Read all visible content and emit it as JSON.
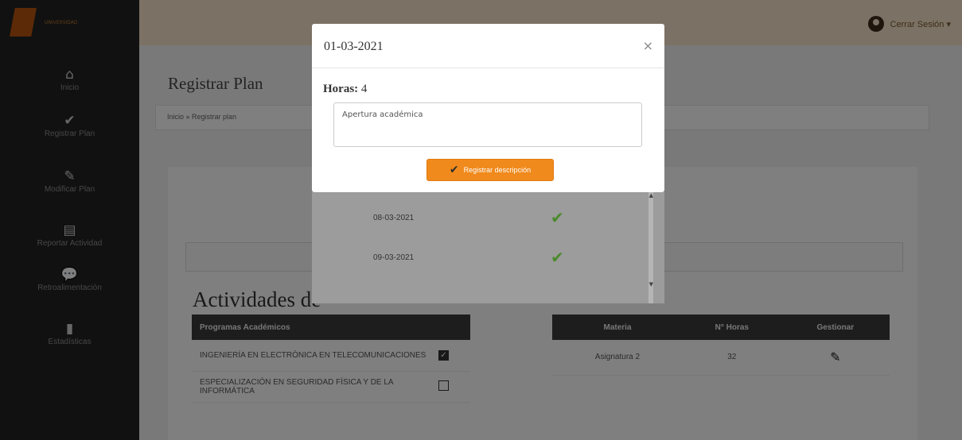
{
  "brand": {
    "logo_text": "UNIVERSIDAD"
  },
  "sidebar": {
    "items": [
      {
        "icon": "home-icon",
        "glyph": "⌂",
        "label": "Inicio"
      },
      {
        "icon": "check-icon",
        "glyph": "✔",
        "label": "Registrar Plan"
      },
      {
        "icon": "pencil-icon",
        "glyph": "✎",
        "label": "Modificar Plan"
      },
      {
        "icon": "file-icon",
        "glyph": "▤",
        "label": "Reportar Actividad"
      },
      {
        "icon": "comment-icon",
        "glyph": "💬",
        "label": "Retroalimentación"
      },
      {
        "icon": "bar-chart-icon",
        "glyph": "▮",
        "label": "Estadísticas"
      }
    ]
  },
  "topbar": {
    "user_name": "Cerrar Sesión ▾"
  },
  "main": {
    "page_title": "Registrar Plan",
    "breadcrumb": "Inicio » Registrar plan",
    "section_title": "Actividades de",
    "programs_table": {
      "header": "Programas Académicos",
      "rows": [
        {
          "name": "INGENIERÍA EN ELECTRÓNICA EN TELECOMUNICACIONES",
          "checked": true
        },
        {
          "name": "ESPECIALIZACIÓN EN SEGURIDAD FÍSICA Y DE LA INFORMÁTICA",
          "checked": false
        }
      ]
    },
    "subjects_table": {
      "headers": [
        "Materia",
        "N° Horas",
        "Gestionar"
      ],
      "rows": [
        {
          "materia": "Asignatura 2",
          "horas": "32"
        }
      ]
    }
  },
  "list_modal": {
    "rows": [
      {
        "date": "08-03-2021",
        "status": "✔"
      },
      {
        "date": "09-03-2021",
        "status": "✔"
      }
    ]
  },
  "modal": {
    "title": "01-03-2021",
    "close": "×",
    "hours_label": "Horas:",
    "hours_value": "4",
    "description_value": "Apertura académica",
    "register_button": "Registrar descripción"
  },
  "colors": {
    "accent": "#f08a1c",
    "sidebar": "#222222",
    "topbar": "#f7e3c8",
    "check_green": "#4a8a2a"
  }
}
